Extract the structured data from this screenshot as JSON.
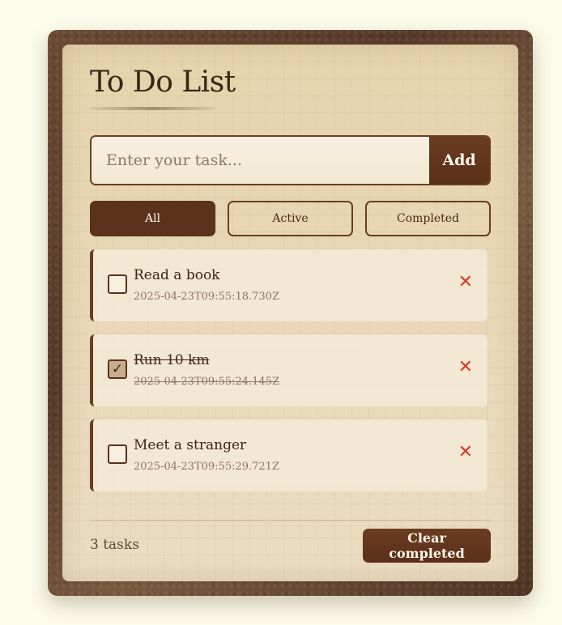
{
  "app": {
    "title": "To Do List"
  },
  "input": {
    "placeholder": "Enter your task...",
    "value": "",
    "add_label": "Add"
  },
  "filters": [
    {
      "label": "All",
      "active": true
    },
    {
      "label": "Active",
      "active": false
    },
    {
      "label": "Completed",
      "active": false
    }
  ],
  "tasks": [
    {
      "text": "Read a book",
      "date": "2025-04-23T09:55:18.730Z",
      "completed": false,
      "check_glyph": ""
    },
    {
      "text": "Run 10 km",
      "date": "2025-04-23T09:55:24.145Z",
      "completed": true,
      "check_glyph": "✓"
    },
    {
      "text": "Meet a stranger",
      "date": "2025-04-23T09:55:29.721Z",
      "completed": false,
      "check_glyph": ""
    }
  ],
  "delete_glyph": "✕",
  "footer": {
    "count_text": "3 tasks",
    "clear_label": "Clear completed"
  },
  "colors": {
    "page_background": "#fdfbea",
    "accent": "#5b331c",
    "delete": "#d43b2c",
    "paper": "#e8d8b6"
  }
}
